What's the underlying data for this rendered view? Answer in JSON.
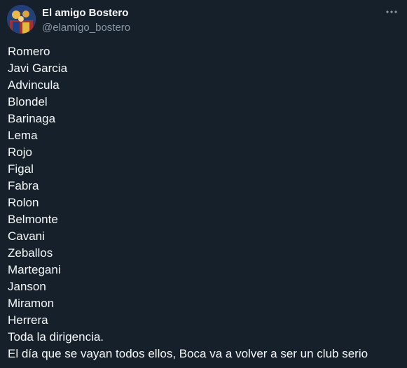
{
  "tweet": {
    "author": {
      "display_name": "El amigo Bostero",
      "handle": "@elamigo_bostero"
    },
    "more_icon": "more-horizontal-icon",
    "lines": [
      "Romero",
      "Javi Garcia",
      "Advincula",
      "Blondel",
      "Barinaga",
      "Lema",
      "Rojo",
      "Figal",
      "Fabra",
      "Rolon",
      "Belmonte",
      "Cavani",
      "Zeballos",
      "Martegani",
      "Janson",
      "Miramon",
      "Herrera",
      "Toda la dirigencia.",
      "El día que se vayan todos ellos, Boca va a volver a ser un club serio"
    ]
  },
  "colors": {
    "background": "#15202b",
    "text_primary": "#f7f9f9",
    "text_secondary": "#8b98a5"
  }
}
